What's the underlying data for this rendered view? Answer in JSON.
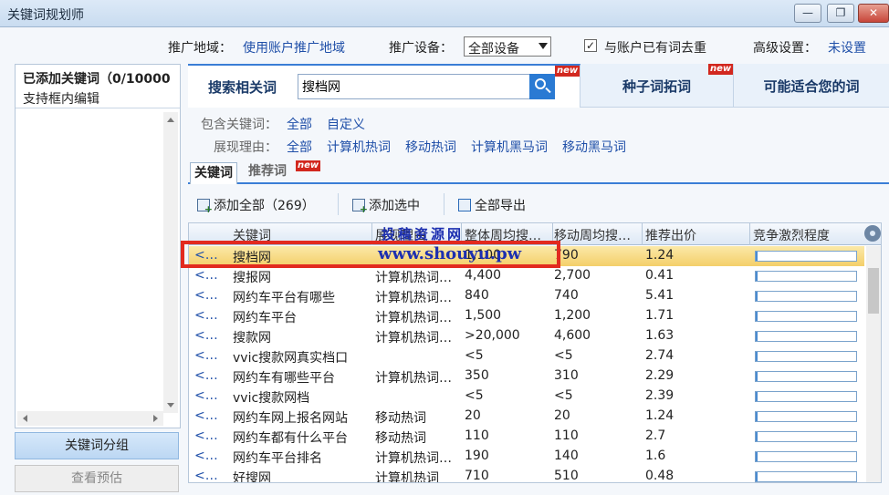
{
  "window": {
    "title": "关键词规划师",
    "min_label": "—",
    "max_label": "❐",
    "close_label": "✕"
  },
  "settings": {
    "region_label": "推广地域：",
    "region_value": "使用账户推广地域",
    "device_label": "推广设备：",
    "device_value": "全部设备",
    "dedupe_label": "与账户已有词去重",
    "dedupe_checked": "✓",
    "advanced_label": "高级设置：",
    "advanced_value": "未设置"
  },
  "left": {
    "header_title": "已添加关键词（0/10000",
    "header_sub": "支持框内编辑",
    "group_button": "关键词分组",
    "preview_button": "查看预估"
  },
  "tabs": {
    "search_label": "搜索相关词",
    "search_value": "搜档网",
    "new_badge": "new",
    "seed_label": "种子词拓词",
    "suit_label": "可能适合您的词"
  },
  "filters": {
    "include_label": "包含关键词：",
    "include_options": [
      "全部",
      "自定义"
    ],
    "reason_label": "展现理由：",
    "reason_options": [
      "全部",
      "计算机热词",
      "移动热词",
      "计算机黑马词",
      "移动黑马词"
    ]
  },
  "subtabs": {
    "keywords": "关键词",
    "recommended": "推荐词"
  },
  "toolbar": {
    "add_all": "添加全部（269）",
    "add_selected": "添加选中",
    "export_all": "全部导出"
  },
  "table": {
    "headers": [
      "关键词",
      "展现理由",
      "整体周均搜…",
      "移动周均搜…",
      "推荐出价",
      "竞争激烈程度"
    ],
    "rows": [
      {
        "op": "<…",
        "kw": "搜档网",
        "reason": "",
        "pc": "1,100",
        "mob": "790",
        "bid": "1.24",
        "comp": 0.02
      },
      {
        "op": "<…",
        "kw": "搜报网",
        "reason": "计算机热词…",
        "pc": "4,400",
        "mob": "2,700",
        "bid": "0.41",
        "comp": 0.02
      },
      {
        "op": "<…",
        "kw": "网约车平台有哪些",
        "reason": "计算机热词…",
        "pc": "840",
        "mob": "740",
        "bid": "5.41",
        "comp": 0.02
      },
      {
        "op": "<…",
        "kw": "网约车平台",
        "reason": "计算机热词…",
        "pc": "1,500",
        "mob": "1,200",
        "bid": "1.71",
        "comp": 0.02
      },
      {
        "op": "<…",
        "kw": "搜款网",
        "reason": "计算机热词…",
        "pc": ">20,000",
        "mob": "4,600",
        "bid": "1.63",
        "comp": 0.02
      },
      {
        "op": "<…",
        "kw": "vvic搜款网真实档口",
        "reason": "",
        "pc": "<5",
        "mob": "<5",
        "bid": "2.74",
        "comp": 0.02
      },
      {
        "op": "<…",
        "kw": "网约车有哪些平台",
        "reason": "计算机热词…",
        "pc": "350",
        "mob": "310",
        "bid": "2.29",
        "comp": 0.02
      },
      {
        "op": "<…",
        "kw": "vvic搜款网档",
        "reason": "",
        "pc": "<5",
        "mob": "<5",
        "bid": "2.39",
        "comp": 0.02
      },
      {
        "op": "<…",
        "kw": "网约车网上报名网站",
        "reason": "移动热词",
        "pc": "20",
        "mob": "20",
        "bid": "1.24",
        "comp": 0.02
      },
      {
        "op": "<…",
        "kw": "网约车都有什么平台",
        "reason": "移动热词",
        "pc": "110",
        "mob": "110",
        "bid": "2.7",
        "comp": 0.02
      },
      {
        "op": "<…",
        "kw": "网约车平台排名",
        "reason": "计算机热词…",
        "pc": "190",
        "mob": "140",
        "bid": "1.6",
        "comp": 0.02
      },
      {
        "op": "<…",
        "kw": "好搜网",
        "reason": "计算机热词",
        "pc": "710",
        "mob": "510",
        "bid": "0.48",
        "comp": 0.02
      }
    ]
  },
  "watermark": {
    "line1": "投稿资源网",
    "line2": "www.shouyu.pw"
  }
}
